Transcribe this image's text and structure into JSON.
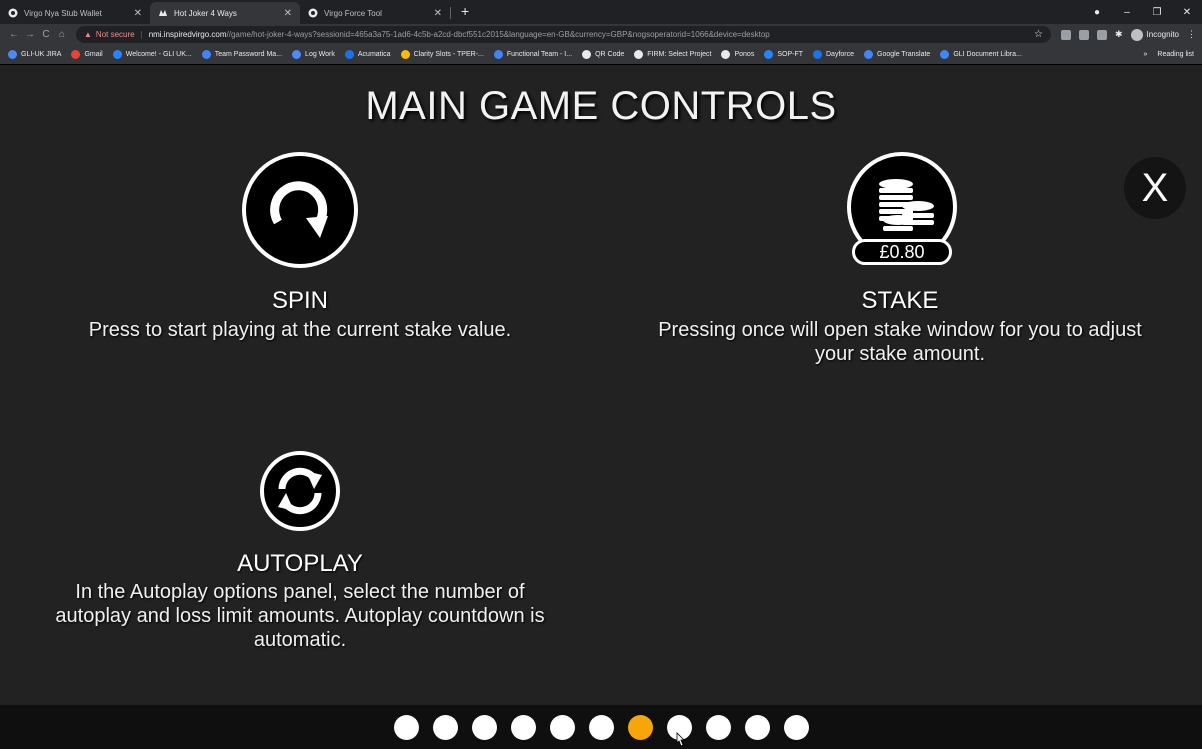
{
  "browser": {
    "tabs": [
      {
        "title": "Virgo Nya Stub Wallet",
        "active": false
      },
      {
        "title": "Hot Joker 4 Ways",
        "active": true
      },
      {
        "title": "Virgo Force Tool",
        "active": false
      }
    ],
    "new_tab": "+",
    "window_controls": {
      "minimize": "–",
      "restore": "❐",
      "close": "✕"
    },
    "address": {
      "security_label": "Not secure",
      "host": "nmi.inspiredvirgo.com",
      "path": "//game/hot-joker-4-ways?sessionid=465a3a75-1ad6-4c5b-a2cd-dbcf551c2015&language=en-GB&currency=GBP&nogsoperatorid=1066&device=desktop"
    },
    "profile_label": "Incognito",
    "bookmarks": [
      {
        "label": "GLI-UK JIRA",
        "color": "#4c8bf5"
      },
      {
        "label": "Gmail",
        "color": "#ea4335"
      },
      {
        "label": "Welcome! - GLI UK...",
        "color": "#2684ff"
      },
      {
        "label": "Team Password Ma...",
        "color": "#4285f4"
      },
      {
        "label": "Log Work",
        "color": "#4c8bf5"
      },
      {
        "label": "Acumatica",
        "color": "#1a73e8"
      },
      {
        "label": "Clarity Slots - TPER-...",
        "color": "#fbbc04"
      },
      {
        "label": "Functional Team - I...",
        "color": "#4285f4"
      },
      {
        "label": "QR Code",
        "color": "#e8eaed"
      },
      {
        "label": "FIRM: Select Project",
        "color": "#e8eaed"
      },
      {
        "label": "Ponos",
        "color": "#e8eaed"
      },
      {
        "label": "SOP-FT",
        "color": "#2684ff"
      },
      {
        "label": "Dayforce",
        "color": "#1a73e8"
      },
      {
        "label": "Google Translate",
        "color": "#4285f4"
      },
      {
        "label": "GLI Document Libra...",
        "color": "#4285f4"
      }
    ],
    "bookmarks_overflow": "»",
    "reading_list": "Reading list"
  },
  "page": {
    "title": "MAIN GAME CONTROLS",
    "close_label": "X",
    "controls": {
      "spin": {
        "title": "SPIN",
        "description": "Press to start playing at the current stake value."
      },
      "stake": {
        "title": "STAKE",
        "value": "£0.80",
        "description_line1": "Pressing once will open stake window for you to adjust",
        "description_line2": "your stake amount."
      },
      "autoplay": {
        "title": "AUTOPLAY",
        "description_line1": "In the Autoplay options panel, select the number of",
        "description_line2": "autoplay and loss limit amounts. Autoplay countdown is",
        "description_line3": "automatic."
      }
    },
    "pagination": {
      "total": 11,
      "current": 7,
      "active_color": "#f6a609"
    }
  }
}
